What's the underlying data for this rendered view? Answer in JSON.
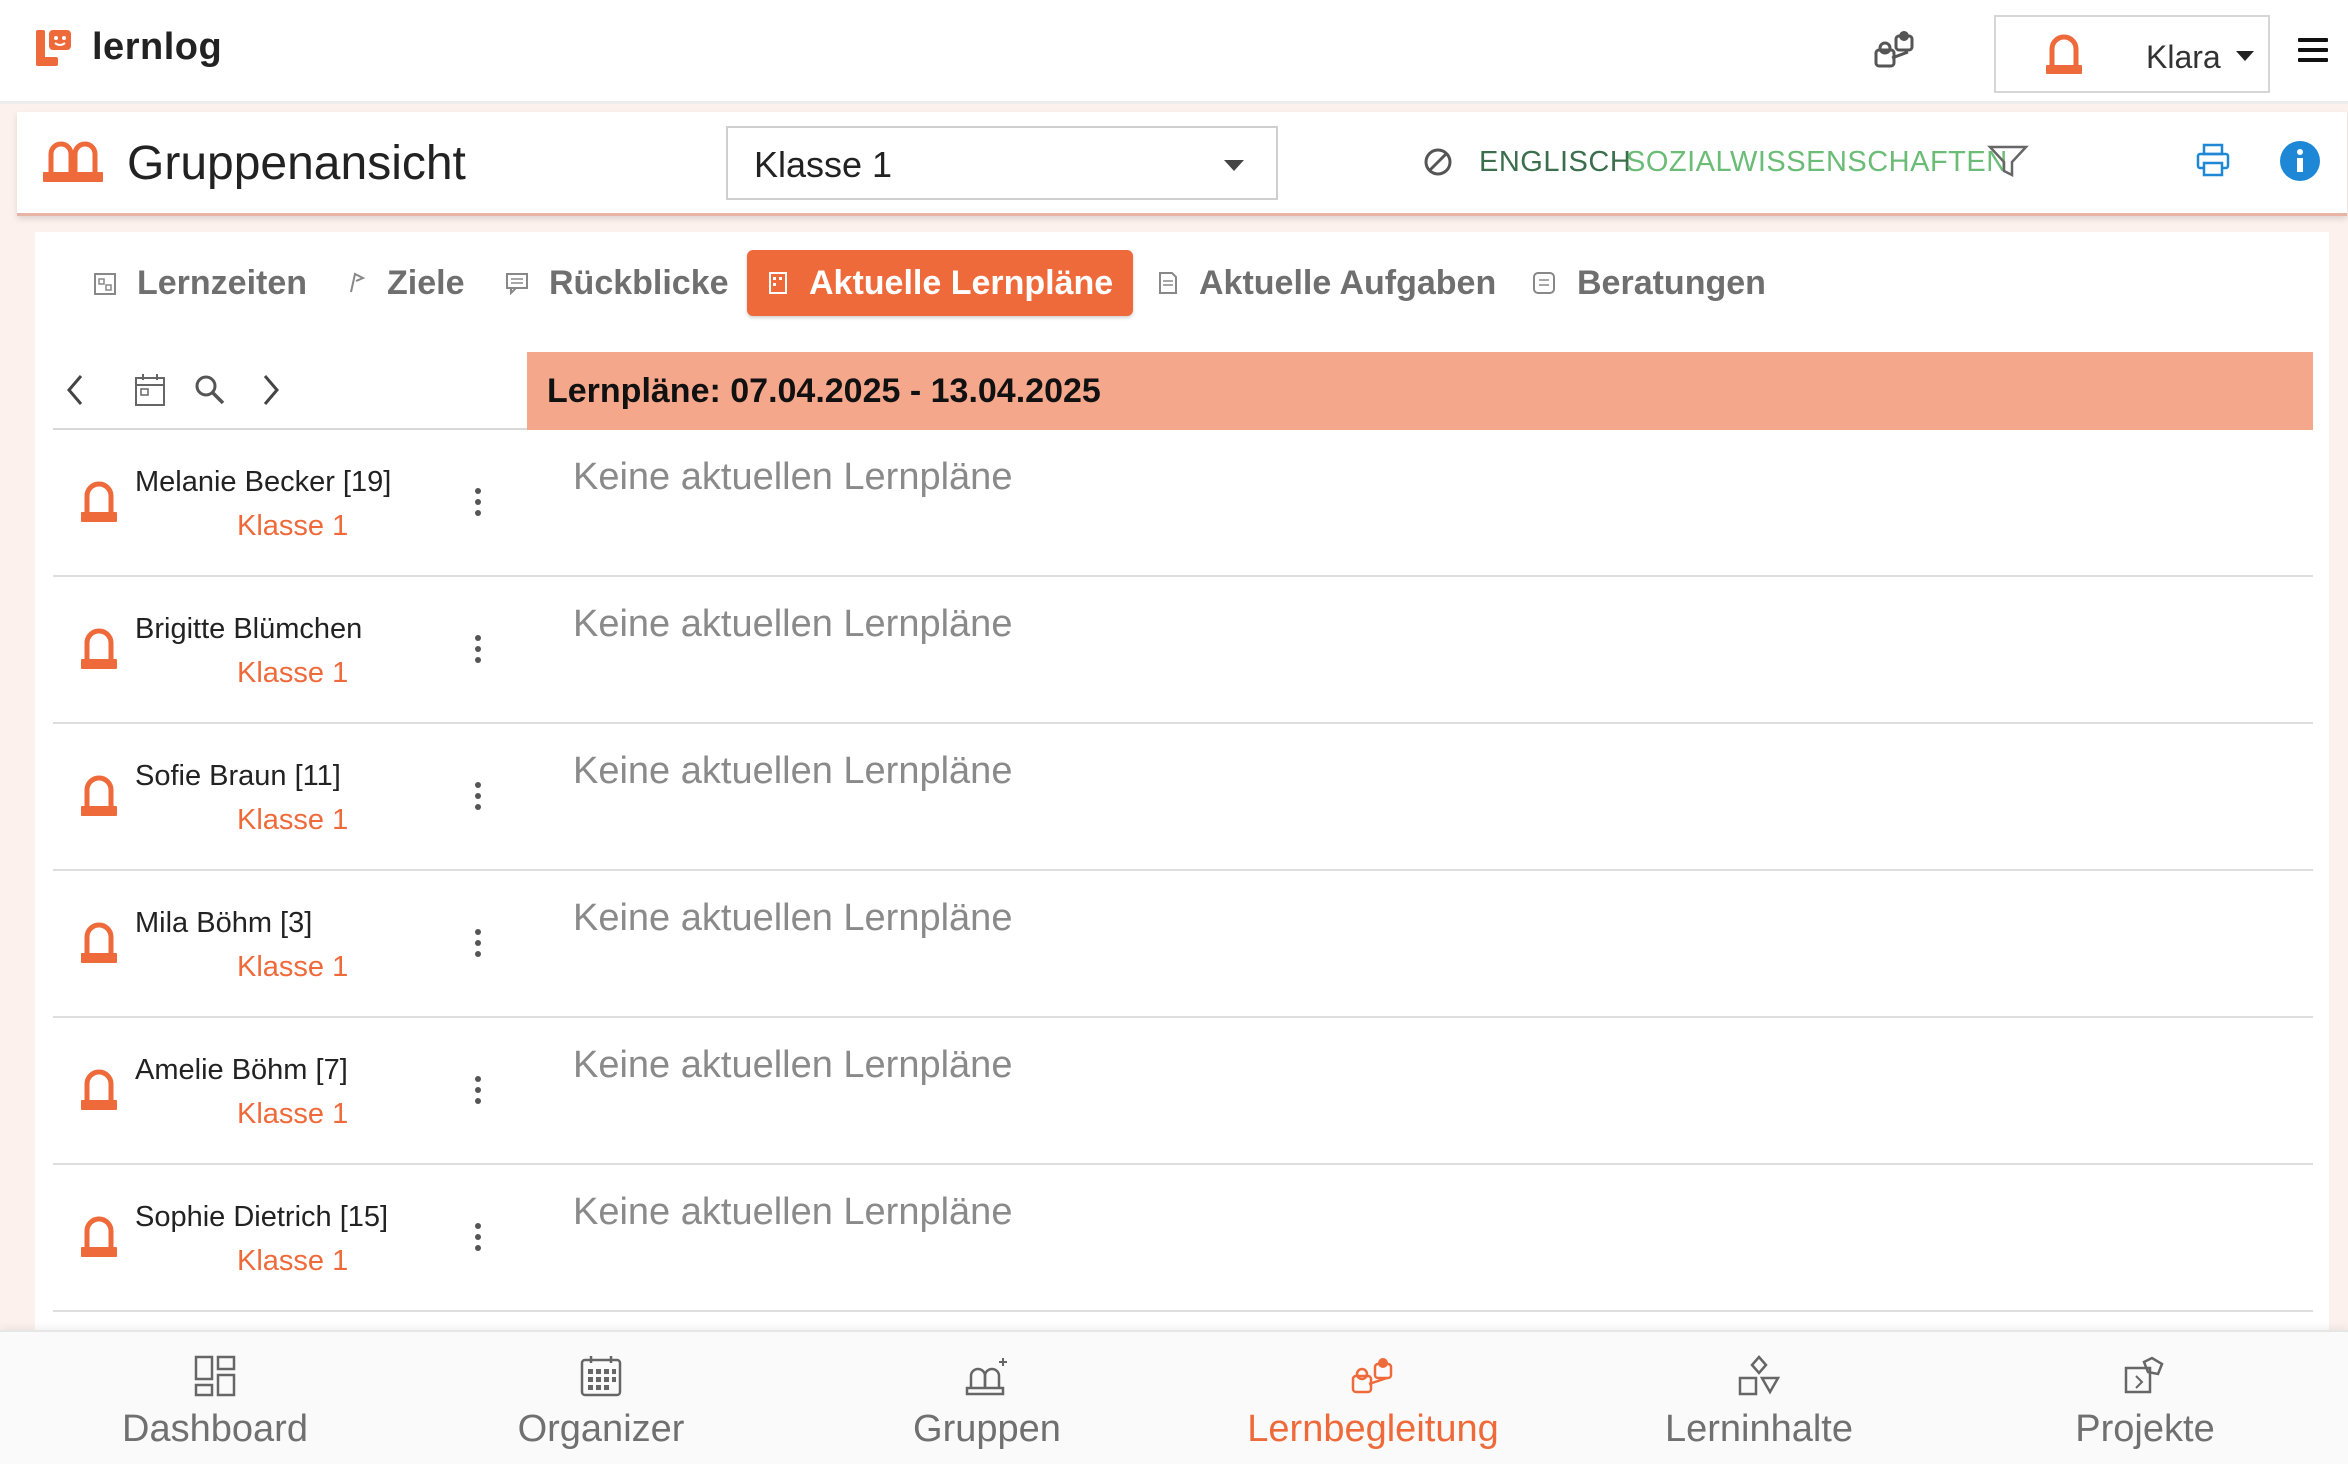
{
  "app": {
    "logo_text": "lernlog"
  },
  "user": {
    "name": "Klara"
  },
  "header": {
    "title": "Gruppenansicht",
    "class_value": "Klasse 1",
    "subjects": [
      "ENGLISCH",
      "SOZIALWISSENSCHAFTEN"
    ]
  },
  "tabs": [
    {
      "label": "Lernzeiten",
      "icon": "calendar-grid-icon"
    },
    {
      "label": "Ziele",
      "icon": "flag-icon"
    },
    {
      "label": "Rückblicke",
      "icon": "comment-icon"
    },
    {
      "label": "Aktuelle Lernpläne",
      "icon": "plan-icon",
      "active": true
    },
    {
      "label": "Aktuelle Aufgaben",
      "icon": "document-icon"
    },
    {
      "label": "Beratungen",
      "icon": "note-icon"
    }
  ],
  "week": {
    "title": "Lernpläne: 07.04.2025 - 13.04.2025"
  },
  "students": [
    {
      "name": "Melanie Becker [19]",
      "class": "Klasse 1",
      "status": "Keine aktuellen Lernpläne"
    },
    {
      "name": "Brigitte Blümchen",
      "class": "Klasse 1",
      "status": "Keine aktuellen Lernpläne"
    },
    {
      "name": "Sofie Braun [11]",
      "class": "Klasse 1",
      "status": "Keine aktuellen Lernpläne"
    },
    {
      "name": "Mila Böhm [3]",
      "class": "Klasse 1",
      "status": "Keine aktuellen Lernpläne"
    },
    {
      "name": "Amelie Böhm [7]",
      "class": "Klasse 1",
      "status": "Keine aktuellen Lernpläne"
    },
    {
      "name": "Sophie Dietrich [15]",
      "class": "Klasse 1",
      "status": "Keine aktuellen Lernpläne"
    }
  ],
  "bottom_nav": [
    {
      "label": "Dashboard",
      "icon": "dashboard-icon"
    },
    {
      "label": "Organizer",
      "icon": "organizer-calendar-icon"
    },
    {
      "label": "Gruppen",
      "icon": "groups-icon"
    },
    {
      "label": "Lernbegleitung",
      "icon": "mentoring-icon",
      "active": true
    },
    {
      "label": "Lerninhalte",
      "icon": "shapes-icon"
    },
    {
      "label": "Projekte",
      "icon": "projects-icon"
    }
  ],
  "colors": {
    "accent": "#ef6a3a",
    "week_bar": "#f4a78b",
    "subject_dark": "#3a6e4c",
    "subject_light": "#6bbc76",
    "info_blue": "#1e88d6"
  }
}
